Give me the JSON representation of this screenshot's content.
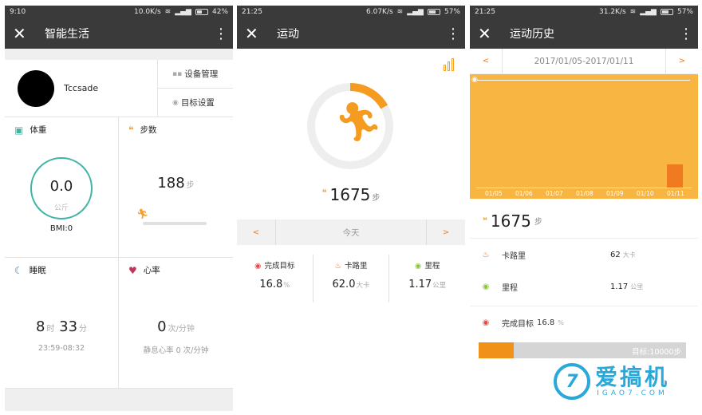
{
  "p1": {
    "status": {
      "time": "9:10",
      "speed": "10.0K/s",
      "battery": "42%"
    },
    "title": "智能生活",
    "user": "Tccsade",
    "menu": [
      "设备管理",
      "目标设置"
    ],
    "weight": {
      "label": "体重",
      "value": "0.0",
      "unit": "公斤",
      "bmi": "BMI:0"
    },
    "steps": {
      "label": "步数",
      "value": "188",
      "unit": "步"
    },
    "sleep": {
      "label": "睡眠",
      "h": "8",
      "h_unit": "时",
      "m": "33",
      "m_unit": "分",
      "range": "23:59-08:32"
    },
    "heart": {
      "label": "心率",
      "value": "0",
      "unit": "次/分钟",
      "rest": "静息心率 0 次/分钟"
    }
  },
  "p2": {
    "status": {
      "time": "21:25",
      "speed": "6.07K/s",
      "battery": "57%"
    },
    "title": "运动",
    "steps": "1675",
    "steps_unit": "步",
    "progress": 0.168,
    "nav": {
      "prev": "<",
      "label": "今天",
      "next": ">"
    },
    "stats": [
      {
        "label": "完成目标",
        "value": "16.8",
        "unit": "%"
      },
      {
        "label": "卡路里",
        "value": "62.0",
        "unit": "大卡"
      },
      {
        "label": "里程",
        "value": "1.17",
        "unit": "公里"
      }
    ]
  },
  "p3": {
    "status": {
      "time": "21:25",
      "speed": "31.2K/s",
      "battery": "57%"
    },
    "title": "运动历史",
    "nav": {
      "prev": "<",
      "label": "2017/01/05-2017/01/11",
      "next": ">"
    },
    "chart_data": {
      "type": "bar",
      "categories": [
        "01/05",
        "01/06",
        "01/07",
        "01/08",
        "01/09",
        "01/10",
        "01/11"
      ],
      "values": [
        0,
        0,
        0,
        0,
        0,
        0,
        1675
      ],
      "ylim": [
        0,
        10000
      ]
    },
    "steps": "1675",
    "steps_unit": "步",
    "calories": {
      "label": "卡路里",
      "value": "62",
      "unit": "大卡"
    },
    "distance": {
      "label": "里程",
      "value": "1.17",
      "unit": "公里"
    },
    "goal": {
      "label": "完成目标",
      "value": "16.8",
      "unit": "%",
      "target": "目标:10000步",
      "fraction": 0.168
    }
  },
  "watermark": {
    "cn": "爱搞机",
    "en": "IGAO7.COM",
    "logo": "7"
  },
  "colors": {
    "accent": "#f59b1f",
    "teal": "#3fb5a6",
    "bar": "#3a3a3a"
  }
}
